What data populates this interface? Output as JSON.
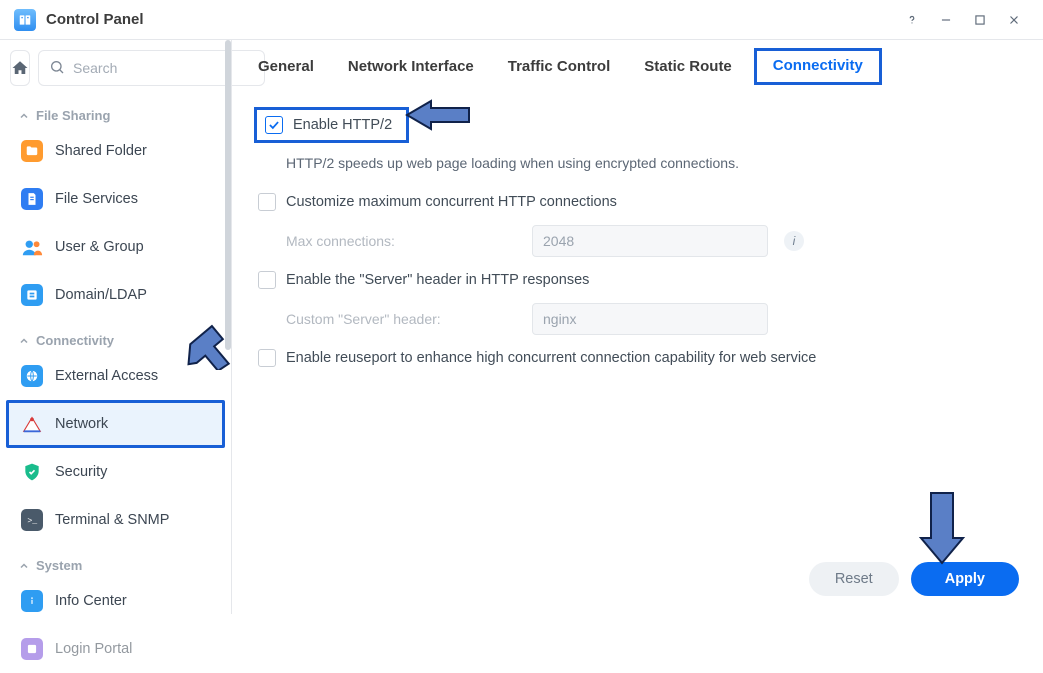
{
  "app": {
    "title": "Control Panel"
  },
  "search": {
    "placeholder": "Search"
  },
  "sidebar": {
    "sections": [
      {
        "label": "File Sharing",
        "items": [
          {
            "label": "Shared Folder"
          },
          {
            "label": "File Services"
          },
          {
            "label": "User & Group"
          },
          {
            "label": "Domain/LDAP"
          }
        ]
      },
      {
        "label": "Connectivity",
        "items": [
          {
            "label": "External Access"
          },
          {
            "label": "Network"
          },
          {
            "label": "Security"
          },
          {
            "label": "Terminal & SNMP"
          }
        ]
      },
      {
        "label": "System",
        "items": [
          {
            "label": "Info Center"
          },
          {
            "label": "Login Portal"
          }
        ]
      }
    ]
  },
  "tabs": {
    "items": [
      {
        "label": "General"
      },
      {
        "label": "Network Interface"
      },
      {
        "label": "Traffic Control"
      },
      {
        "label": "Static Route"
      },
      {
        "label": "Connectivity"
      }
    ]
  },
  "content": {
    "enable_http2": {
      "label": "Enable HTTP/2",
      "checked": true
    },
    "http2_desc": "HTTP/2 speeds up web page loading when using encrypted connections.",
    "customize_max": {
      "label": "Customize maximum concurrent HTTP connections",
      "checked": false
    },
    "max_conn": {
      "label": "Max connections:",
      "value": "2048"
    },
    "server_header": {
      "label": "Enable the \"Server\" header in HTTP responses",
      "checked": false
    },
    "custom_server": {
      "label": "Custom \"Server\" header:",
      "value": "nginx"
    },
    "reuseport": {
      "label": "Enable reuseport to enhance high concurrent connection capability for web service",
      "checked": false
    }
  },
  "footer": {
    "reset": "Reset",
    "apply": "Apply"
  }
}
